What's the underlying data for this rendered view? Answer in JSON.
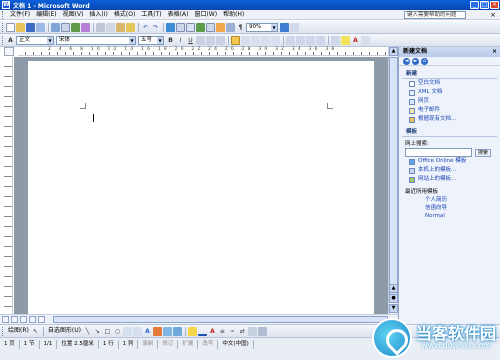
{
  "window": {
    "title": "文档 1 - Microsoft Word",
    "app_icon": "W",
    "buttons": {
      "minimize": "_",
      "maximize": "□",
      "close": "×"
    }
  },
  "menubar": {
    "items": [
      "文件(F)",
      "编辑(E)",
      "视图(V)",
      "插入(I)",
      "格式(O)",
      "工具(T)",
      "表格(A)",
      "窗口(W)",
      "帮助(H)"
    ],
    "help_placeholder": "键入需要帮助的问题",
    "close_glyph": "×"
  },
  "toolbar_format": {
    "style": "正文",
    "font": "宋体",
    "size": "五号",
    "bold": "B",
    "italic": "I",
    "underline": "U",
    "zoom": "90%"
  },
  "ruler": {
    "numbers": "2 4 6 8 10 12 14 16 18 20 22 24 26 28 30 32 34 36 38"
  },
  "taskpane": {
    "title": "新建文档",
    "close_glyph": "×",
    "sections": {
      "new": "新建",
      "templates": "模板"
    },
    "new_links": [
      "空白文档",
      "XML 文档",
      "网页",
      "电子邮件",
      "根据现有文档..."
    ],
    "search_label": "网上搜索:",
    "search_button": "搜索",
    "template_links": [
      "Office Online 模板",
      "本机上的模板...",
      "网站上的模板..."
    ],
    "recent_label": "最近所用模板",
    "recent_items": [
      "个人简历",
      "信函向导",
      "Normal"
    ]
  },
  "drawbar": {
    "draw_label": "绘图(R)",
    "autoshapes_label": "自选图形(U)"
  },
  "statusbar": {
    "page": "1 页",
    "section": "1 节",
    "page_of": "1/1",
    "position": "位置 2.5厘米",
    "line": "1 行",
    "column": "1 列",
    "rec": "录制",
    "trk": "修订",
    "ext": "扩展",
    "ovr": "改写",
    "lang": "中文(中国)"
  },
  "watermark": {
    "name": "当客软件园",
    "url": "www.downkr.com"
  }
}
